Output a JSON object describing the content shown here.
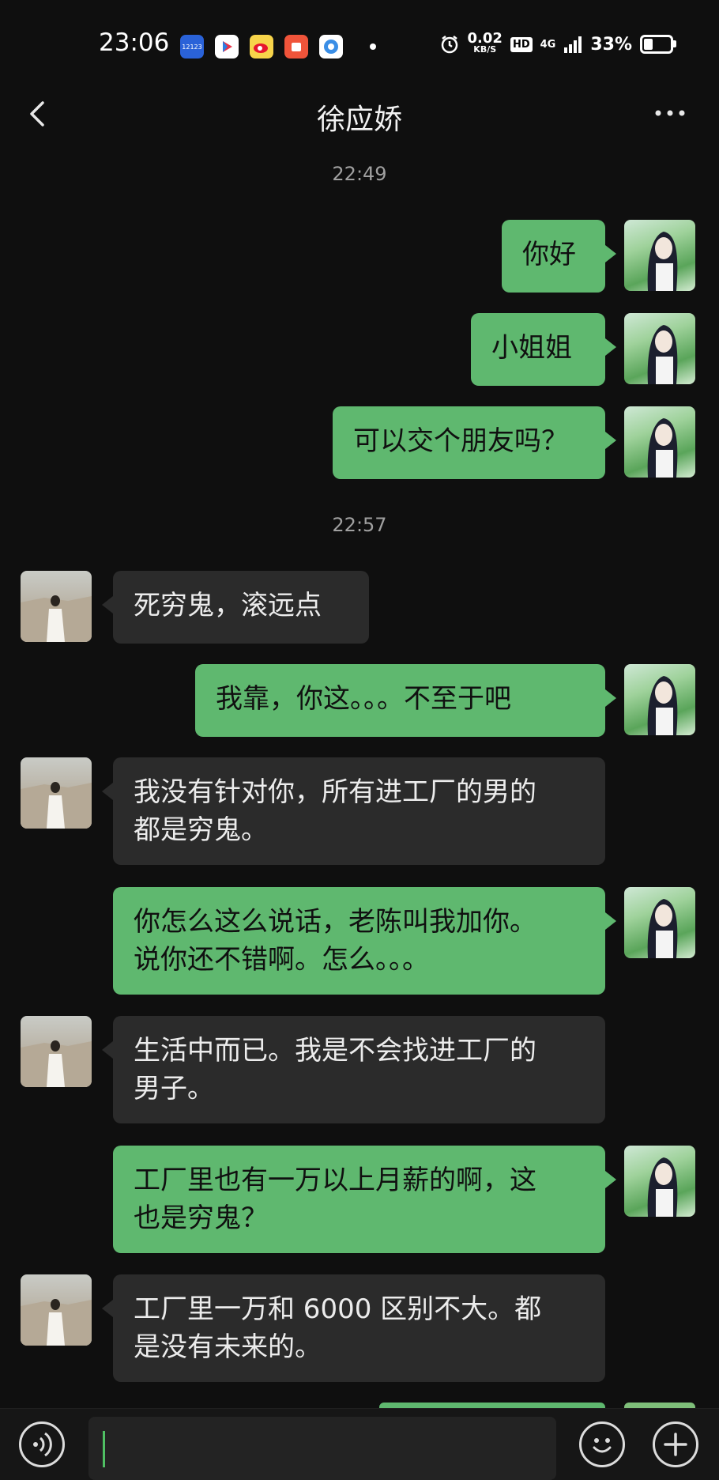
{
  "status_bar": {
    "time": "23:06",
    "net_speed_value": "0.02",
    "net_speed_unit": "KB/S",
    "hd": "HD",
    "signal": "4G",
    "battery": "33%",
    "apps": [
      "12123",
      "video-app",
      "weibo",
      "taobao-app",
      "browser"
    ]
  },
  "nav": {
    "title": "徐应娇",
    "back_icon": "chevron-left-icon",
    "more_icon": "more-horizontal-icon"
  },
  "timestamps": [
    "22:49",
    "22:57"
  ],
  "messages": [
    {
      "from": "me",
      "text": "你好"
    },
    {
      "from": "me",
      "text": "小姐姐"
    },
    {
      "from": "me",
      "text": "可以交个朋友吗？"
    },
    {
      "from": "her",
      "text": "死穷鬼，滚远点"
    },
    {
      "from": "me",
      "text": "我靠，你这。。。不至于吧"
    },
    {
      "from": "her",
      "text": "我没有针对你，所有进工厂的男的\n都是穷鬼。"
    },
    {
      "from": "me",
      "text": "你怎么这么说话，老陈叫我加你。\n说你还不错啊。怎么。。。"
    },
    {
      "from": "her",
      "text": "生活中而已。我是不会找进工厂的\n男子。"
    },
    {
      "from": "me",
      "text": "工厂里也有一万以上月薪的啊，这\n也是穷鬼？"
    },
    {
      "from": "her",
      "text": "工厂里一万和 6000 区别不大。都\n是没有未来的。"
    }
  ],
  "input_bar": {
    "voice_icon": "voice-icon",
    "emoji_icon": "emoji-icon",
    "plus_icon": "plus-icon",
    "value": ""
  },
  "colors": {
    "background": "#0f0f0f",
    "my_bubble": "#5fb86f",
    "her_bubble": "#2b2b2b",
    "accent": "#4fbf63"
  }
}
